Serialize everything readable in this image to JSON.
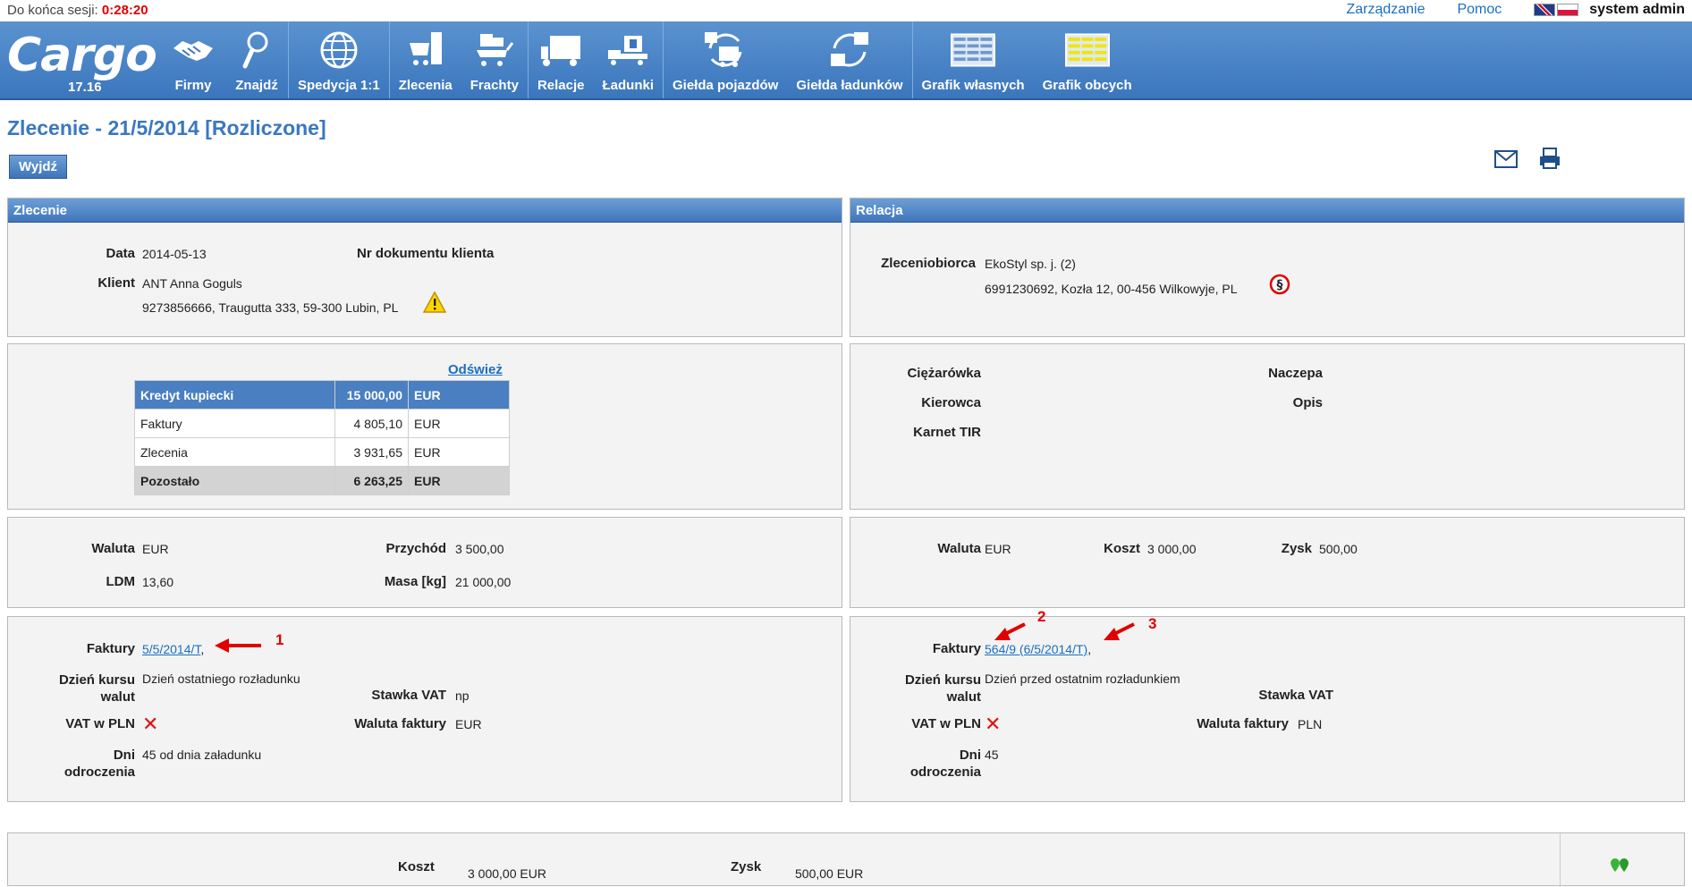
{
  "session": {
    "label": "Do końca sesji:",
    "time": "0:28:20"
  },
  "topnav": {
    "manage": "Zarządzanie",
    "help": "Pomoc",
    "user": "system admin"
  },
  "menu": {
    "brand": "Cargo",
    "version": "17.16",
    "items": [
      "Firmy",
      "Znajdź",
      "Spedycja 1:1",
      "Zlecenia",
      "Frachty",
      "Relacje",
      "Ładunki",
      "Giełda pojazdów",
      "Giełda ładunków",
      "Grafik własnych",
      "Grafik obcych"
    ]
  },
  "page": {
    "title": "Zlecenie - 21/5/2014 [Rozliczone]",
    "exit": "Wyjdź"
  },
  "left": {
    "header": "Zlecenie",
    "date_label": "Data",
    "date": "2014-05-13",
    "doc_label": "Nr dokumentu klienta",
    "client_label": "Klient",
    "client_name": "ANT Anna Goguls",
    "client_addr": "9273856666, Traugutta 333, 59-300 Lubin, PL",
    "refresh": "Odśwież",
    "credit": {
      "header": [
        "Kredyt kupiecki",
        "15 000,00",
        "EUR"
      ],
      "rows": [
        [
          "Faktury",
          "4 805,10",
          "EUR"
        ],
        [
          "Zlecenia",
          "3 931,65",
          "EUR"
        ]
      ],
      "sum": [
        "Pozostało",
        "6 263,25",
        "EUR"
      ]
    },
    "currency_label": "Waluta",
    "currency": "EUR",
    "income_label": "Przychód",
    "income": "3 500,00",
    "ldm_label": "LDM",
    "ldm": "13,60",
    "mass_label": "Masa [kg]",
    "mass": "21 000,00",
    "invoices_label": "Faktury",
    "invoice_link": "5/5/2014/T",
    "rate_day_label1": "Dzień kursu",
    "rate_day_label2": "walut",
    "rate_day": "Dzień ostatniego rozładunku",
    "vat_rate_label": "Stawka VAT",
    "vat_rate": "np",
    "vat_pln_label": "VAT w PLN",
    "inv_currency_label": "Waluta faktury",
    "inv_currency": "EUR",
    "days_label1": "Dni",
    "days_label2": "odroczenia",
    "days": "45 od dnia załadunku"
  },
  "right": {
    "header": "Relacja",
    "carrier_label": "Zleceniobiorca",
    "carrier_name": "EkoStyl sp. j. (2)",
    "carrier_addr": "6991230692, Kozła 12, 00-456 Wilkowyje, PL",
    "truck_label": "Ciężarówka",
    "trailer_label": "Naczepa",
    "driver_label": "Kierowca",
    "desc_label": "Opis",
    "tir_label": "Karnet TIR",
    "currency_label": "Waluta",
    "currency": "EUR",
    "cost_label": "Koszt",
    "cost": "3 000,00",
    "profit_label": "Zysk",
    "profit": "500,00",
    "invoices_label": "Faktury",
    "invoice_link": "564/9 (6/5/2014/T)",
    "rate_day_label1": "Dzień kursu",
    "rate_day_label2": "walut",
    "rate_day": "Dzień przed ostatnim rozładunkiem",
    "vat_rate_label": "Stawka VAT",
    "vat_pln_label": "VAT w PLN",
    "inv_currency_label": "Waluta faktury",
    "inv_currency": "PLN",
    "days_label1": "Dni",
    "days_label2": "odroczenia",
    "days": "45"
  },
  "bottom": {
    "cost_label": "Koszt",
    "cost": "3 000,00 EUR",
    "profit_label": "Zysk",
    "profit": "500,00 EUR"
  },
  "annotations": [
    "1",
    "2",
    "3"
  ],
  "colors": {
    "menu_blue": "#3b76bd",
    "title_blue": "#3a78c0",
    "link_blue": "#1a6fc2",
    "alert_red": "#e00000"
  }
}
